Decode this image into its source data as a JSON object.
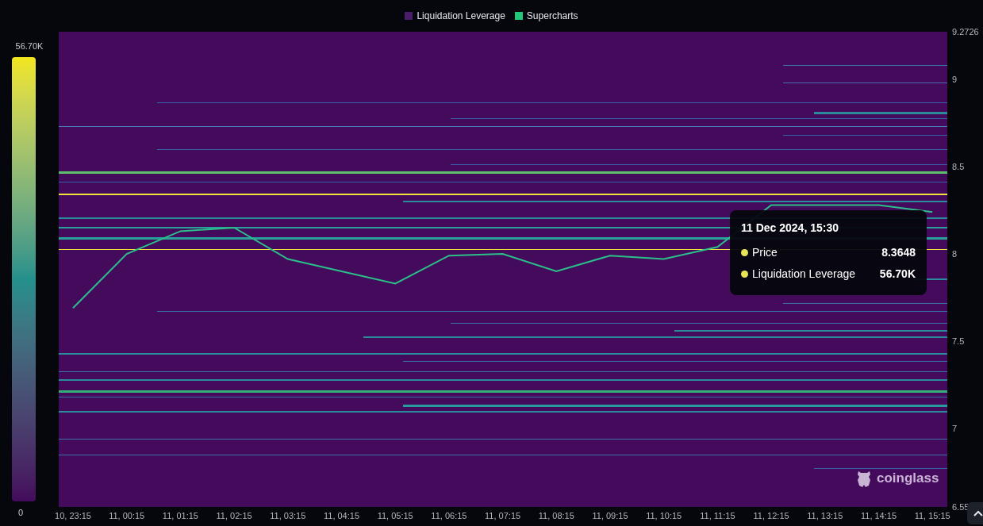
{
  "legend": [
    {
      "label": "Liquidation Leverage",
      "color": "#4a1d6b"
    },
    {
      "label": "Supercharts",
      "color": "#22c77a"
    }
  ],
  "colorbar": {
    "max_label": "56.70K",
    "min_label": "0"
  },
  "chart": {
    "chart_data": {
      "type": "line",
      "categories": [
        "10, 23:15",
        "11, 00:15",
        "11, 01:15",
        "11, 02:15",
        "11, 03:15",
        "11, 04:15",
        "11, 05:15",
        "11, 06:15",
        "11, 07:15",
        "11, 08:15",
        "11, 09:15",
        "11, 10:15",
        "11, 11:15",
        "11, 12:15",
        "11, 13:15",
        "11, 14:15",
        "11, 15:15"
      ],
      "series": [
        {
          "color": "#2bbf8a",
          "values": [
            7.69,
            8.0,
            8.13,
            8.15,
            7.97,
            7.9,
            7.83,
            7.99,
            8.0,
            7.9,
            7.99,
            7.97,
            8.04,
            8.28,
            8.28,
            8.28,
            8.24
          ]
        }
      ],
      "ylim": [
        6.55,
        9.2726
      ],
      "yticks": [
        6.55,
        7,
        7.5,
        8,
        8.5,
        9,
        9.2726
      ]
    }
  },
  "tooltip": {
    "title": "11 Dec 2024, 15:30",
    "rows": [
      {
        "label": "Price",
        "value": "8.3648"
      },
      {
        "label": "Liquidation Leverage",
        "value": "56.70K"
      }
    ]
  },
  "watermark_logo": {
    "text": "coinglass"
  }
}
